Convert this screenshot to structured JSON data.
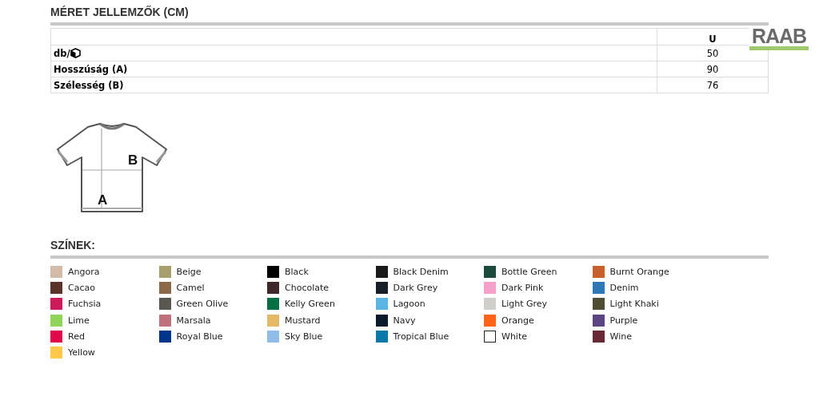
{
  "size_section": {
    "title": "MÉRET JELLEMZŐK (CM)",
    "columns": [
      "U"
    ],
    "rows": [
      {
        "label": "db/",
        "has_box_icon": true,
        "values": [
          "50"
        ]
      },
      {
        "label": "Hosszúság (A)",
        "has_box_icon": false,
        "values": [
          "90"
        ]
      },
      {
        "label": "Szélesség (B)",
        "has_box_icon": false,
        "values": [
          "76"
        ]
      }
    ]
  },
  "logo": {
    "text": "RAAB"
  },
  "diagram": {
    "label_length": "A",
    "label_width": "B"
  },
  "colors_section": {
    "title": "SZÍNEK:",
    "colors": [
      {
        "name": "Angora",
        "color": "#d2bba8"
      },
      {
        "name": "Beige",
        "color": "#a89f6e"
      },
      {
        "name": "Black",
        "color": "#000000"
      },
      {
        "name": "Black Denim",
        "color": "#1a1a1a"
      },
      {
        "name": "Bottle Green",
        "color": "#1c4a3c"
      },
      {
        "name": "Burnt Orange",
        "color": "#c8602c"
      },
      {
        "name": "Cacao",
        "color": "#5a3328"
      },
      {
        "name": "Camel",
        "color": "#8a6848"
      },
      {
        "name": "Chocolate",
        "color": "#40282a"
      },
      {
        "name": "Dark Grey",
        "color": "#161e28"
      },
      {
        "name": "Dark Pink",
        "color": "#f5a0c8"
      },
      {
        "name": "Denim",
        "color": "#2e78b8"
      },
      {
        "name": "Fuchsia",
        "color": "#cc1a5a"
      },
      {
        "name": "Green Olive",
        "color": "#585850"
      },
      {
        "name": "Kelly Green",
        "color": "#057044"
      },
      {
        "name": "Lagoon",
        "color": "#5ab4e4"
      },
      {
        "name": "Light Grey",
        "color": "#d0cfcc"
      },
      {
        "name": "Light Khaki",
        "color": "#4e4e34"
      },
      {
        "name": "Lime",
        "color": "#90d45a"
      },
      {
        "name": "Marsala",
        "color": "#c0707a"
      },
      {
        "name": "Mustard",
        "color": "#e4b864"
      },
      {
        "name": "Navy",
        "color": "#0a1a2c"
      },
      {
        "name": "Orange",
        "color": "#ff6418"
      },
      {
        "name": "Purple",
        "color": "#5a4482"
      },
      {
        "name": "Red",
        "color": "#e0084a"
      },
      {
        "name": "Royal Blue",
        "color": "#00358c"
      },
      {
        "name": "Sky Blue",
        "color": "#90bce8"
      },
      {
        "name": "Tropical Blue",
        "color": "#0878a8"
      },
      {
        "name": "White",
        "color": "#ffffff"
      },
      {
        "name": "Wine",
        "color": "#6a2834"
      },
      {
        "name": "Yellow",
        "color": "#ffc848"
      }
    ]
  }
}
